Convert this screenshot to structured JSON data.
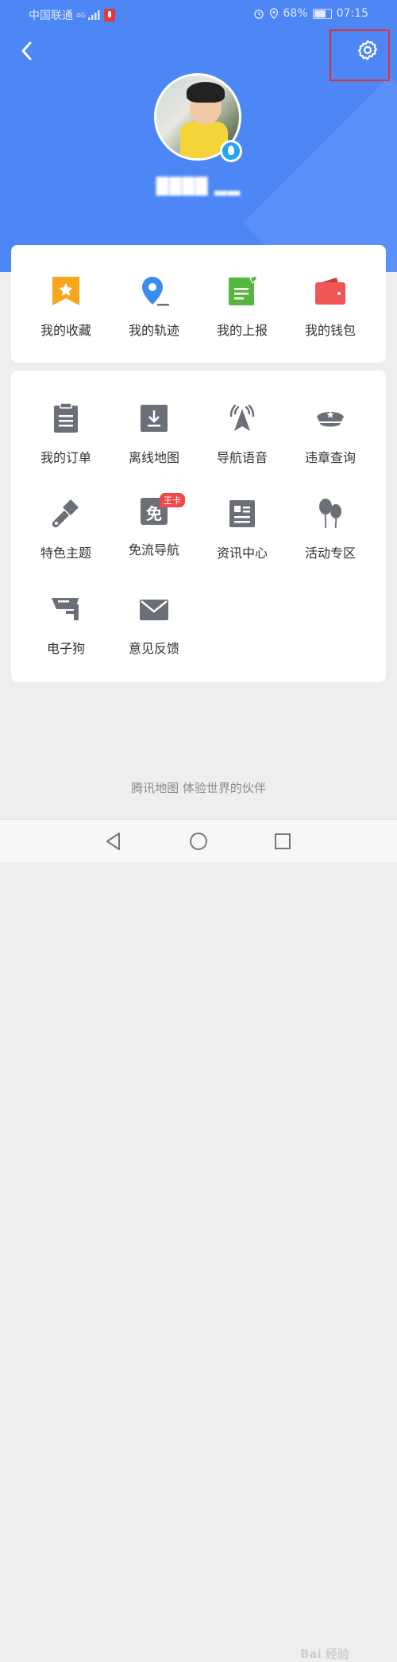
{
  "status_bar": {
    "carrier": "中国联通",
    "network": "4G",
    "battery": "68%",
    "time": "07:15",
    "icons": [
      "signal-icon",
      "mic-icon",
      "alarm-icon",
      "location-icon",
      "battery-icon"
    ]
  },
  "header": {
    "background_color": "#4d86f5",
    "username": "████ ▂▂",
    "back_icon": "back-arrow-icon",
    "settings_icon": "gear-icon",
    "highlight_color": "#e03131"
  },
  "top_menu": [
    {
      "label": "我的收藏",
      "icon": "bookmark-star-icon",
      "color": "#f7a51c"
    },
    {
      "label": "我的轨迹",
      "icon": "location-pin-icon",
      "color": "#3c8cf0"
    },
    {
      "label": "我的上报",
      "icon": "report-icon",
      "color": "#56b740"
    },
    {
      "label": "我的钱包",
      "icon": "wallet-icon",
      "color": "#ef5656"
    }
  ],
  "main_menu": [
    {
      "label": "我的订单",
      "icon": "order-clipboard-icon"
    },
    {
      "label": "离线地图",
      "icon": "download-icon"
    },
    {
      "label": "导航语音",
      "icon": "navigation-voice-icon"
    },
    {
      "label": "违章查询",
      "icon": "police-cap-icon"
    },
    {
      "label": "特色主题",
      "icon": "paint-brush-icon"
    },
    {
      "label": "免流导航",
      "icon": "free-data-icon",
      "badge": "王卡",
      "glyph": "免"
    },
    {
      "label": "资讯中心",
      "icon": "news-icon"
    },
    {
      "label": "活动专区",
      "icon": "balloons-icon"
    },
    {
      "label": "电子狗",
      "icon": "camera-icon"
    },
    {
      "label": "意见反馈",
      "icon": "mail-icon"
    }
  ],
  "footer": "腾讯地图  体验世界的伙伴",
  "watermark": "Bai 经验",
  "colors": {
    "icon_gray": "#6b6f78",
    "badge_red": "#ef4a4a"
  }
}
